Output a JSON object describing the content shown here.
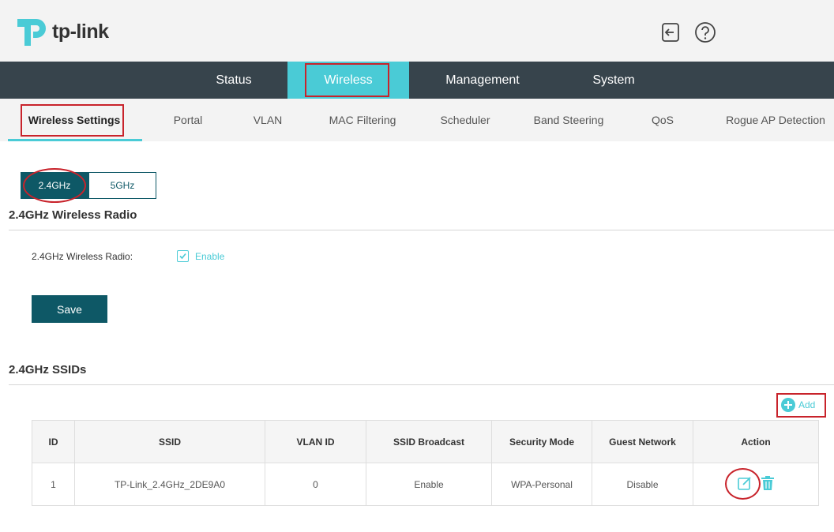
{
  "header": {
    "logo_text": "tp-link",
    "logout_icon": "logout-icon",
    "help_icon": "help-icon"
  },
  "main_nav": {
    "items": [
      {
        "label": "Status"
      },
      {
        "label": "Wireless",
        "active": true
      },
      {
        "label": "Management"
      },
      {
        "label": "System"
      }
    ]
  },
  "sub_nav": {
    "items": [
      {
        "label": "Wireless Settings",
        "active": true
      },
      {
        "label": "Portal"
      },
      {
        "label": "VLAN"
      },
      {
        "label": "MAC Filtering"
      },
      {
        "label": "Scheduler"
      },
      {
        "label": "Band Steering"
      },
      {
        "label": "QoS"
      },
      {
        "label": "Rogue AP Detection"
      }
    ]
  },
  "band_tabs": [
    {
      "label": "2.4GHz",
      "active": true
    },
    {
      "label": "5GHz"
    }
  ],
  "radio_section": {
    "title": "2.4GHz Wireless Radio",
    "field_label": "2.4GHz Wireless Radio:",
    "checkbox_label": "Enable",
    "checked": true,
    "save_label": "Save"
  },
  "ssid_section": {
    "title": "2.4GHz SSIDs",
    "add_label": "Add",
    "columns": [
      "ID",
      "SSID",
      "VLAN ID",
      "SSID Broadcast",
      "Security Mode",
      "Guest Network",
      "Action"
    ],
    "rows": [
      {
        "id": "1",
        "ssid": "TP-Link_2.4GHz_2DE9A0",
        "vlan_id": "0",
        "broadcast": "Enable",
        "security": "WPA-Personal",
        "guest": "Disable"
      }
    ]
  },
  "colors": {
    "accent": "#4acbd6",
    "dark_teal": "#0e5866",
    "nav_bg": "#37444c",
    "highlight": "#c8232b"
  }
}
